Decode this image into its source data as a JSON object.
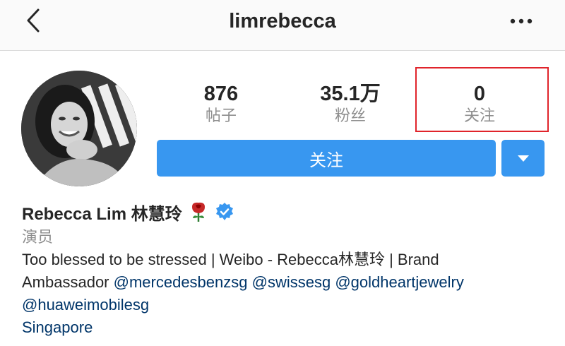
{
  "nav": {
    "back_icon": "chevron-left-icon",
    "title": "limrebecca",
    "more_icon": "more-dots-icon"
  },
  "profile": {
    "avatar_icon": "avatar",
    "stats": {
      "posts": {
        "value": "876",
        "label": "帖子"
      },
      "followers": {
        "value": "35.1万",
        "label": "粉丝"
      },
      "following": {
        "value": "0",
        "label": "关注"
      }
    },
    "follow_button_label": "关注",
    "dropdown_icon": "triangle-down-icon",
    "name": "Rebecca Lim 林慧玲",
    "name_emoji": "rose-icon",
    "verified_icon": "verified-badge-icon",
    "category": "演员",
    "bio": {
      "line1": "Too blessed to be stressed | Weibo - Rebecca林慧玲 | Brand",
      "line2_prefix": "Ambassador ",
      "mentions": [
        "@mercedesbenzsg",
        "@swissesg",
        "@goldheartjewelry",
        "@huaweimobilesg"
      ],
      "location": "Singapore"
    }
  },
  "colors": {
    "accent": "#3897f0",
    "highlight_border": "#e0242b",
    "link": "#003569",
    "muted": "#8e8e8e"
  }
}
